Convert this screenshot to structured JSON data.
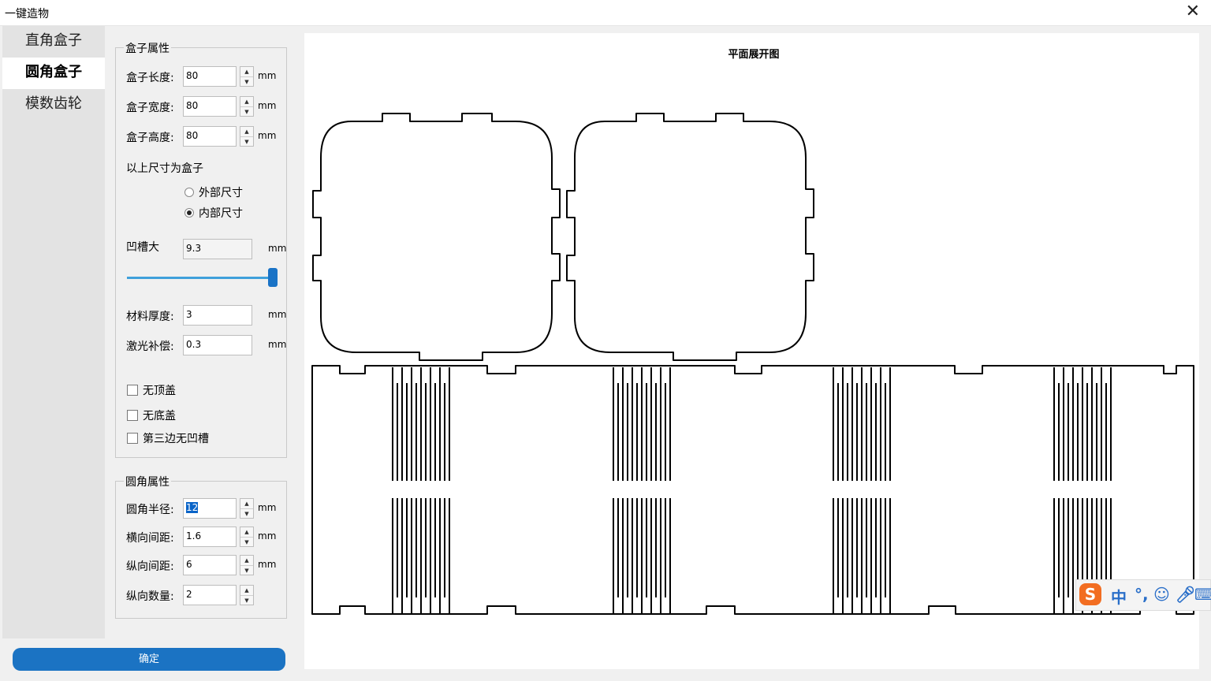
{
  "window": {
    "title": "一键造物"
  },
  "nav": {
    "items": [
      {
        "label": "直角盒子"
      },
      {
        "label": "圆角盒子"
      },
      {
        "label": "模数齿轮"
      }
    ]
  },
  "box_props": {
    "title": "盒子属性",
    "length": {
      "label": "盒子长度:",
      "value": "80",
      "unit": "mm"
    },
    "width": {
      "label": "盒子宽度:",
      "value": "80",
      "unit": "mm"
    },
    "height": {
      "label": "盒子高度:",
      "value": "80",
      "unit": "mm"
    },
    "size_note": "以上尺寸为盒子",
    "radio_outer": "外部尺寸",
    "radio_inner": "内部尺寸",
    "slot": {
      "label": "凹槽大",
      "value": "9.3",
      "unit": "mm",
      "level": 1.0
    },
    "thickness": {
      "label": "材料厚度:",
      "value": "3",
      "unit": "mm"
    },
    "laser": {
      "label": "激光补偿:",
      "value": "0.3",
      "unit": "mm"
    },
    "check_no_top": "无顶盖",
    "check_no_bottom": "无底盖",
    "check_no_third": "第三边无凹槽"
  },
  "round_props": {
    "title": "圆角属性",
    "radius": {
      "label": "圆角半径:",
      "value": "12",
      "unit": "mm"
    },
    "h_gap": {
      "label": "横向间距:",
      "value": "1.6",
      "unit": "mm"
    },
    "v_gap": {
      "label": "纵向间距:",
      "value": "6",
      "unit": "mm"
    },
    "v_count": {
      "label": "纵向数量:",
      "value": "2"
    }
  },
  "buttons": {
    "ok": "确定"
  },
  "preview": {
    "title": "平面展开图"
  },
  "ime": {
    "mode": "中",
    "punct": "°,"
  },
  "colors": {
    "accent": "#1b73c3",
    "slider": "#3fa0db"
  }
}
